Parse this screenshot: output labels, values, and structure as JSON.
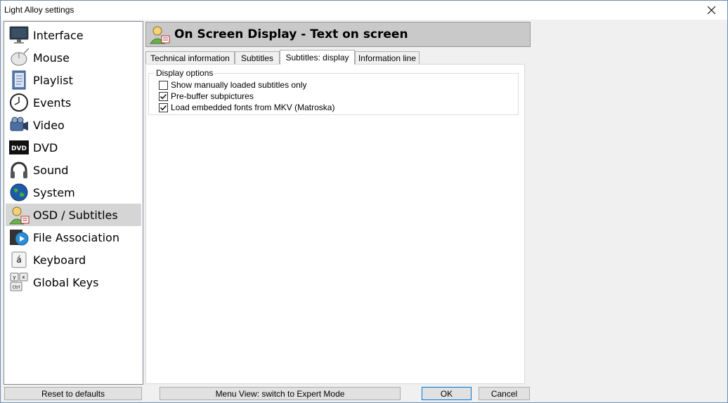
{
  "window": {
    "title": "Light Alloy settings"
  },
  "sidebar": {
    "items": [
      {
        "label": "Interface",
        "icon": "monitor-icon"
      },
      {
        "label": "Mouse",
        "icon": "mouse-icon"
      },
      {
        "label": "Playlist",
        "icon": "notebook-icon"
      },
      {
        "label": "Events",
        "icon": "clock-icon"
      },
      {
        "label": "Video",
        "icon": "camcorder-icon"
      },
      {
        "label": "DVD",
        "icon": "dvd-icon"
      },
      {
        "label": "Sound",
        "icon": "headphones-icon"
      },
      {
        "label": "System",
        "icon": "globe-icon"
      },
      {
        "label": "OSD / Subtitles",
        "icon": "person-subtitles-icon"
      },
      {
        "label": "File Association",
        "icon": "media-file-icon"
      },
      {
        "label": "Keyboard",
        "icon": "key-icon"
      },
      {
        "label": "Global Keys",
        "icon": "keyboard-keys-icon"
      }
    ],
    "active_index": 8
  },
  "header": {
    "title": "On Screen Display - Text on screen"
  },
  "tabs": [
    {
      "label": "Technical information"
    },
    {
      "label": "Subtitles"
    },
    {
      "label": "Subtitles: display"
    },
    {
      "label": "Information line"
    }
  ],
  "active_tab": 2,
  "display_options": {
    "group_label": "Display options",
    "options": [
      {
        "label": "Show manually loaded subtitles only",
        "checked": false
      },
      {
        "label": "Pre-buffer subpictures",
        "checked": true
      },
      {
        "label": "Load embedded fonts from MKV (Matroska)",
        "checked": true
      }
    ]
  },
  "footer": {
    "reset_label": "Reset to defaults",
    "menu_view_label": "Menu View: switch to Expert Mode",
    "ok_label": "OK",
    "cancel_label": "Cancel"
  },
  "colors": {
    "active_item_bg": "#d5d5d5",
    "header_bg": "#c9c9c9"
  }
}
